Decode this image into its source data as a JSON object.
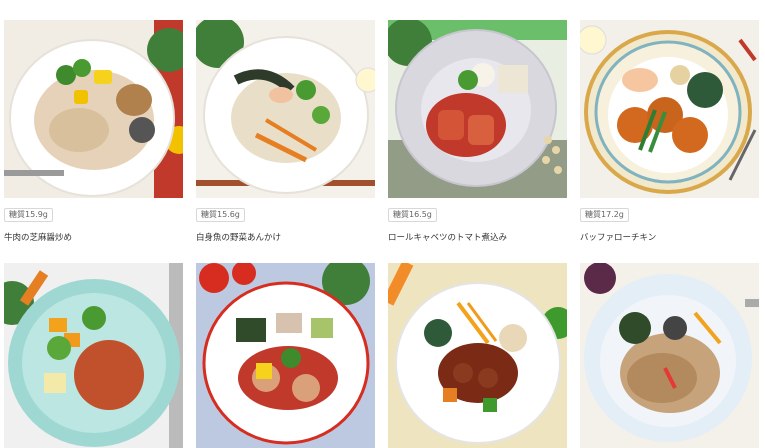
{
  "menu": {
    "items": [
      {
        "sugar": "糖質15.9g",
        "name": "牛肉の芝麻醤炒め",
        "photo_icon": "beef-sesame-stirfry-photo"
      },
      {
        "sugar": "糖質15.6g",
        "name": "白身魚の野菜あんかけ",
        "photo_icon": "white-fish-vegetable-sauce-photo"
      },
      {
        "sugar": "糖質16.5g",
        "name": "ロールキャベツのトマト煮込み",
        "photo_icon": "cabbage-roll-tomato-photo"
      },
      {
        "sugar": "糖質17.2g",
        "name": "バッファローチキン",
        "photo_icon": "buffalo-chicken-photo"
      },
      {
        "photo_icon": "hamburg-vegetables-photo"
      },
      {
        "photo_icon": "chicken-tomato-sauce-photo"
      },
      {
        "photo_icon": "sweet-sour-meatballs-photo"
      },
      {
        "photo_icon": "beef-rice-bowl-photo"
      }
    ]
  }
}
